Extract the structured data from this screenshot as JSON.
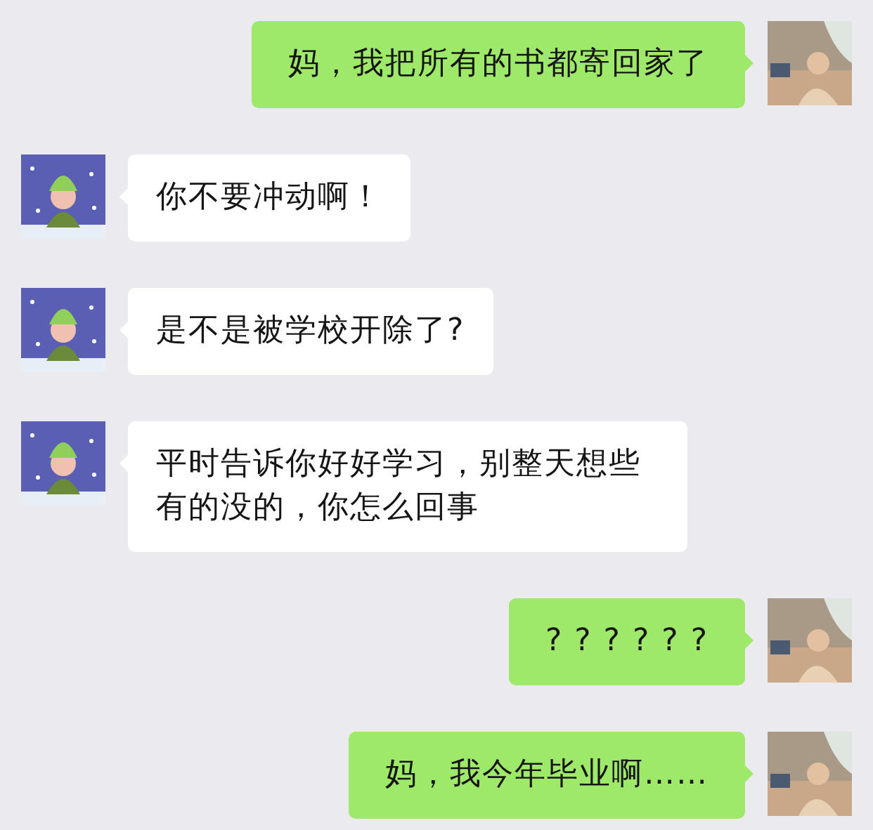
{
  "messages": [
    {
      "kind": "sent",
      "text": "妈，我把所有的书都寄回家了"
    },
    {
      "kind": "received",
      "text": "你不要冲动啊！"
    },
    {
      "kind": "received",
      "text": "是不是被学校开除了?"
    },
    {
      "kind": "received",
      "text": "平时告诉你好好学习，别整天想些有的没的，你怎么回事"
    },
    {
      "kind": "sent",
      "text": "? ? ? ? ? ?"
    },
    {
      "kind": "sent",
      "text": "妈，我今年毕业啊……"
    }
  ]
}
